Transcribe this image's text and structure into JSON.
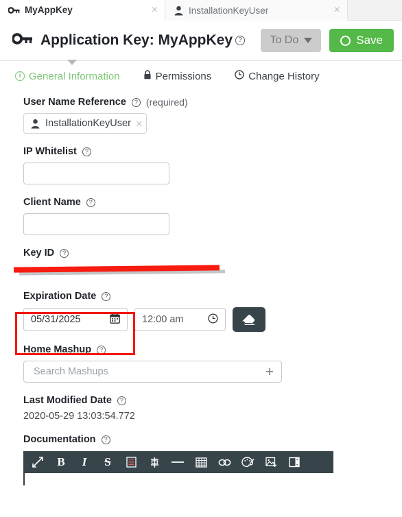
{
  "tabs": [
    {
      "label": "MyAppKey",
      "icon": "key-icon",
      "active": true,
      "close": "×"
    },
    {
      "label": "InstallationKeyUser",
      "icon": "person-icon",
      "active": false,
      "close": "×"
    }
  ],
  "header": {
    "icon": "key-icon",
    "title": "Application Key: MyAppKey",
    "help": "?",
    "status_button": {
      "label": "To Do",
      "icon": "chevron-down-icon"
    },
    "save_button": {
      "label": "Save",
      "icon": "circle-icon"
    }
  },
  "subtabs": [
    {
      "label": "General Information",
      "icon": "info-icon",
      "active": true
    },
    {
      "label": "Permissions",
      "icon": "lock-icon",
      "active": false
    },
    {
      "label": "Change History",
      "icon": "clock-icon",
      "active": false
    }
  ],
  "fields": {
    "user_name_reference": {
      "label": "User Name Reference",
      "help": "?",
      "required_text": "(required)",
      "chip_value": "InstallationKeyUser",
      "chip_close": "×"
    },
    "ip_whitelist": {
      "label": "IP Whitelist",
      "help": "?",
      "value": "",
      "placeholder": ""
    },
    "client_name": {
      "label": "Client Name",
      "help": "?",
      "value": "",
      "placeholder": ""
    },
    "key_id": {
      "label": "Key ID",
      "help": "?",
      "value": "",
      "redacted": true
    },
    "expiration_date": {
      "label": "Expiration Date",
      "help": "?",
      "date_value": "05/31/2025",
      "time_value": "12:00 am",
      "date_icon": "calendar-icon",
      "time_icon": "clock-icon",
      "clear_icon": "eraser-icon"
    },
    "home_mashup": {
      "label": "Home Mashup",
      "help": "?",
      "value": "",
      "placeholder": "Search Mashups",
      "add_icon": "plus-icon"
    },
    "last_modified_date": {
      "label": "Last Modified Date",
      "help": "?",
      "value": "2020-05-29 13:03:54.772"
    },
    "documentation": {
      "label": "Documentation",
      "help": "?"
    }
  },
  "editor_toolbar": [
    {
      "name": "expand-icon",
      "glyph": "⤡"
    },
    {
      "name": "bold-icon",
      "glyph": "B"
    },
    {
      "name": "italic-icon",
      "glyph": "I"
    },
    {
      "name": "strikethrough-icon",
      "glyph": "S"
    },
    {
      "name": "list-icon",
      "glyph": "☰"
    },
    {
      "name": "align-icon",
      "glyph": "⇅"
    },
    {
      "name": "horizontal-rule-icon",
      "glyph": "—"
    },
    {
      "name": "table-icon",
      "glyph": "☷"
    },
    {
      "name": "link-icon",
      "glyph": "⚭"
    },
    {
      "name": "palette-icon",
      "glyph": "⚘"
    },
    {
      "name": "image-icon",
      "glyph": "❑"
    },
    {
      "name": "panel-icon",
      "glyph": "◫"
    }
  ],
  "colors": {
    "accent_green": "#54b948",
    "subtab_green": "#7cc576",
    "toolbar_dark": "#37444a",
    "annotation_red": "#f3170c",
    "disabled_gray": "#cccccc"
  }
}
